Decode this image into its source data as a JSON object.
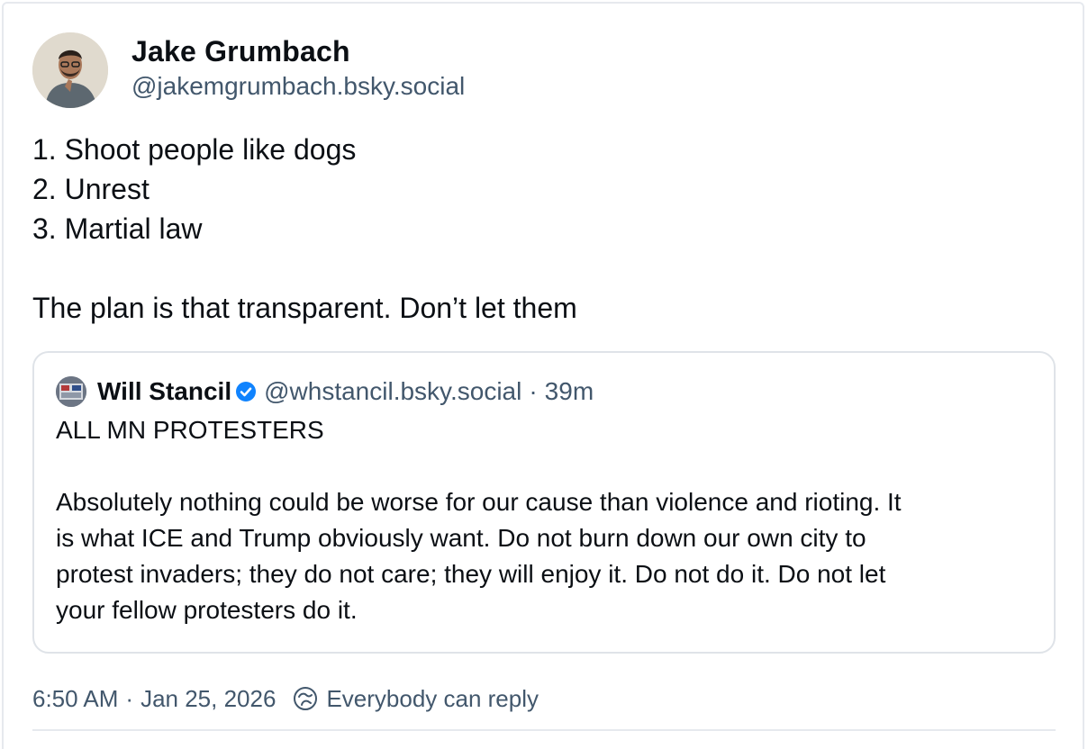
{
  "post": {
    "author": {
      "display_name": "Jake Grumbach",
      "handle": "@jakemgrumbach.bsky.social",
      "avatar_icon": "profile-photo"
    },
    "text_lines": [
      "1. Shoot people like dogs",
      "2. Unrest",
      "3. Martial law",
      "",
      "The plan is that transparent. Don’t let them"
    ],
    "quote": {
      "display_name": "Will Stancil",
      "verified_icon": "verified-check-icon",
      "handle": "@whstancil.bsky.social",
      "separator": "·",
      "time": "39m",
      "text_lines": [
        "ALL MN PROTESTERS",
        "",
        "Absolutely nothing could be worse for our cause than violence and rioting. It",
        "is what ICE and Trump obviously want. Do not burn down our own city to",
        "protest invaders; they do not care; they will enjoy it. Do not do it. Do not let",
        "your fellow protesters do it."
      ]
    },
    "meta": {
      "time": "6:50 AM",
      "separator": "·",
      "date": "Jan 25, 2026",
      "reply_icon": "reply-settings-icon",
      "reply_setting": "Everybody can reply"
    }
  },
  "colors": {
    "text": "#0b0f14",
    "secondary": "#42576c",
    "border": "#dfe3e8",
    "verified": "#1083fe"
  }
}
